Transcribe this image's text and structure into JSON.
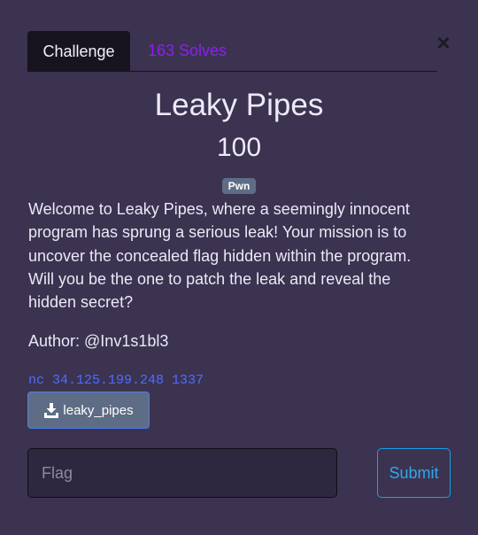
{
  "modal": {
    "close_glyph": "×",
    "tabs": {
      "challenge_label": "Challenge",
      "solves_label": "163 Solves"
    },
    "challenge": {
      "name": "Leaky Pipes",
      "value": "100",
      "category": "Pwn",
      "description": "Welcome to Leaky Pipes, where a seemingly innocent program has sprung a serious leak! Your mission is to uncover the concealed flag hidden within the program. Will you be the one to patch the leak and reveal the hidden secret?",
      "author": "Author: @Inv1s1bl3",
      "connection": "nc 34.125.199.248 1337",
      "file": {
        "label": "leaky_pipes",
        "icon": "download-icon"
      }
    },
    "submission": {
      "flag_placeholder": "Flag",
      "flag_value": "",
      "submit_label": "Submit"
    }
  },
  "colors": {
    "background": "#3b3350",
    "tab_active_bg": "#17141f",
    "solves_link": "#8e1ff0",
    "badge_bg": "#5e6d85",
    "connection_text": "#4d6dff",
    "submit_border": "#19a0e6"
  }
}
